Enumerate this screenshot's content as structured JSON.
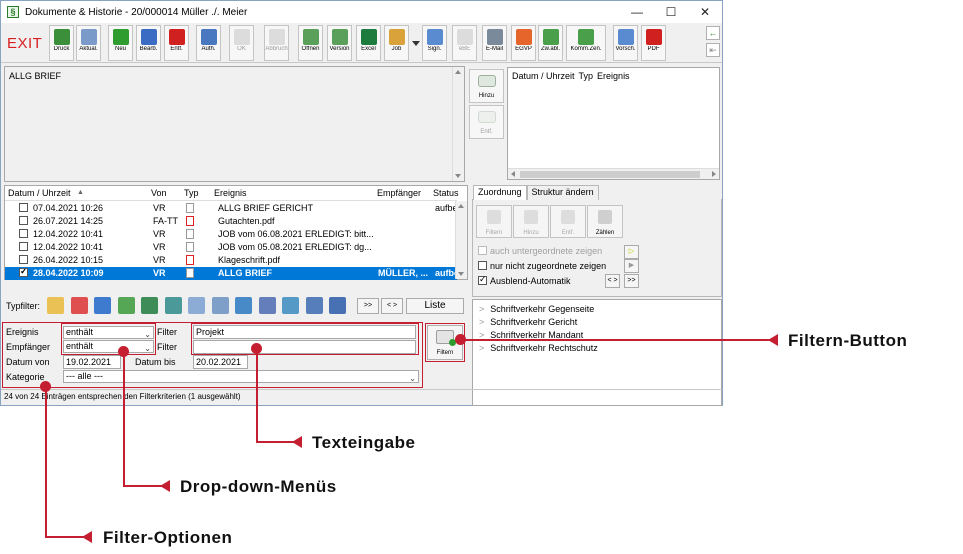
{
  "window": {
    "title": "Dokumente & Historie - 20/000014  Müller ./. Meier",
    "controls": {
      "minimize": "—",
      "maximize": "☐",
      "close": "✕"
    }
  },
  "toolbar": {
    "exit_label": "EXIT",
    "buttons": [
      {
        "label": "Druck",
        "icon": "printer-icon",
        "color": "#3b8f3b"
      },
      {
        "label": "Aktual.",
        "icon": "refresh-icon",
        "color": "#7a9ac9"
      },
      {
        "label": "Neu",
        "icon": "new-icon",
        "color": "#2e9c2e"
      },
      {
        "label": "Bearb.",
        "icon": "edit-icon",
        "color": "#3a6cc4"
      },
      {
        "label": "Entf.",
        "icon": "delete-icon",
        "color": "#d02020"
      },
      {
        "label": "Auth.",
        "icon": "network-icon",
        "color": "#4a78c0"
      },
      {
        "label": "OK",
        "icon": "ok-icon",
        "color": "#bbbbbb"
      },
      {
        "label": "Abbruch",
        "icon": "cancel-icon",
        "color": "#bbbbbb"
      },
      {
        "label": "Öffnen",
        "icon": "open-icon",
        "color": "#5aa05a"
      },
      {
        "label": "Version",
        "icon": "version-icon",
        "color": "#5aa05a"
      },
      {
        "label": "Excel",
        "icon": "excel-icon",
        "color": "#1e7b3e"
      },
      {
        "label": "Job",
        "icon": "job-icon",
        "color": "#d9a23a"
      },
      {
        "label": "Sign.",
        "icon": "sign-icon",
        "color": "#5a8ad0"
      },
      {
        "label": "eBE",
        "icon": "ebe-icon",
        "color": "#bbbbbb"
      },
      {
        "label": "E-Mail",
        "icon": "email-icon",
        "color": "#7a8a9a"
      },
      {
        "label": "EGVP",
        "icon": "egvp-icon",
        "color": "#e5652a"
      },
      {
        "label": "Zw.abl.",
        "icon": "clipboard-icon",
        "color": "#4aa04a"
      },
      {
        "label": "Komm.Zen.",
        "icon": "comm-center-icon",
        "color": "#4aa04a"
      },
      {
        "label": "Vorsch.",
        "icon": "preview-icon",
        "color": "#5a8ad0"
      },
      {
        "label": "PDF",
        "icon": "pdf-icon",
        "color": "#d02020"
      }
    ]
  },
  "editor": {
    "text": "ALLG BRIEF"
  },
  "side_buttons": {
    "add_label": "Hinzu",
    "remove_label": "Entf."
  },
  "history": {
    "columns": [
      "Datum / Uhrzeit",
      "Typ",
      "Ereignis"
    ]
  },
  "documents": {
    "columns": [
      "Datum / Uhrzeit",
      "Von",
      "Typ",
      "Ereignis",
      "Empfänger",
      "Status"
    ],
    "rows": [
      {
        "date": "07.04.2021  10:26",
        "from": "VR",
        "event": "ALLG BRIEF GERICHT",
        "recipient": "",
        "status": "aufbe",
        "type": "doc",
        "checked": false,
        "selected": false
      },
      {
        "date": "26.07.2021  14:25",
        "from": "FA-TT",
        "event": "Gutachten.pdf",
        "recipient": "",
        "status": "",
        "type": "pdf",
        "checked": false,
        "selected": false
      },
      {
        "date": "12.04.2022  10:41",
        "from": "VR",
        "event": "JOB vom 06.08.2021   ERLEDIGT: bitt...",
        "recipient": "",
        "status": "",
        "type": "doc",
        "checked": false,
        "selected": false
      },
      {
        "date": "12.04.2022  10:41",
        "from": "VR",
        "event": "JOB vom 05.08.2021   ERLEDIGT: dg...",
        "recipient": "",
        "status": "",
        "type": "doc",
        "checked": false,
        "selected": false
      },
      {
        "date": "26.04.2022  10:15",
        "from": "VR",
        "event": "Klageschrift.pdf",
        "recipient": "",
        "status": "",
        "type": "pdf",
        "checked": false,
        "selected": false
      },
      {
        "date": "28.04.2022  10:09",
        "from": "VR",
        "event": "ALLG BRIEF",
        "recipient": "MÜLLER, ...",
        "status": "aufbe",
        "type": "doc",
        "checked": true,
        "selected": true
      }
    ]
  },
  "tabs": [
    {
      "label": "Zuordnung",
      "active": true
    },
    {
      "label": "Struktur ändern",
      "active": false
    }
  ],
  "assign_buttons": [
    "Filtern",
    "Hinzu",
    "Entf.",
    "Zählen"
  ],
  "options": {
    "sub_assigned": "auch untergeordnete zeigen",
    "not_assigned": "nur nicht zugeordnete zeigen",
    "auto_hide": "Ausblend-Automatik",
    "nav_prev": "< >",
    "nav_next": ">>"
  },
  "typfilter": {
    "label": "Typfilter:",
    "nav_first": ">>",
    "nav_toggle": "< >",
    "list_label": "Liste"
  },
  "tree": {
    "items": [
      "Schriftverkehr Gegenseite",
      "Schriftverkehr Gericht",
      "Schriftverkehr Mandant",
      "Schriftverkehr Rechtschutz"
    ]
  },
  "filter": {
    "event_label": "Ereignis",
    "event_value": "enthält",
    "recipient_label": "Empfänger",
    "recipient_value": "enthält",
    "filter_label": "Filter",
    "filter_value_1": "Projekt",
    "filter_value_2": "",
    "date_from_label": "Datum von",
    "date_from": "19.02.2021",
    "date_to_label": "Datum bis",
    "date_to": "20.02.2021",
    "category_label": "Kategorie",
    "category_value": "--- alle ---",
    "button_label": "Filtern"
  },
  "status_text": "24 von 24 Einträgen entsprechen den Filterkriterien (1 ausgewählt)",
  "callouts": {
    "filter_button": "Filtern-Button",
    "text_input": "Texteingabe",
    "dropdowns": "Drop-down-Menüs",
    "filter_options": "Filter-Optionen"
  },
  "colors": {
    "accent": "#c41e30",
    "selection": "#0078d7"
  }
}
